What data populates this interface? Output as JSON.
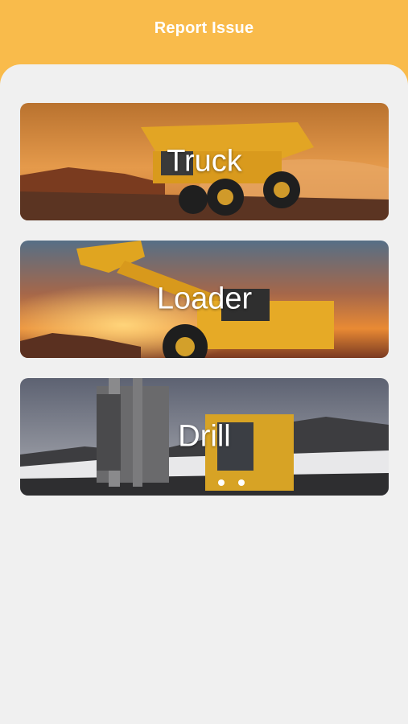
{
  "header": {
    "title": "Report Issue"
  },
  "categories": [
    {
      "label": "Truck"
    },
    {
      "label": "Loader"
    },
    {
      "label": "Drill"
    }
  ],
  "colors": {
    "header": "#f9bb4b",
    "background": "#f0f0f0",
    "label": "#ffffff"
  }
}
